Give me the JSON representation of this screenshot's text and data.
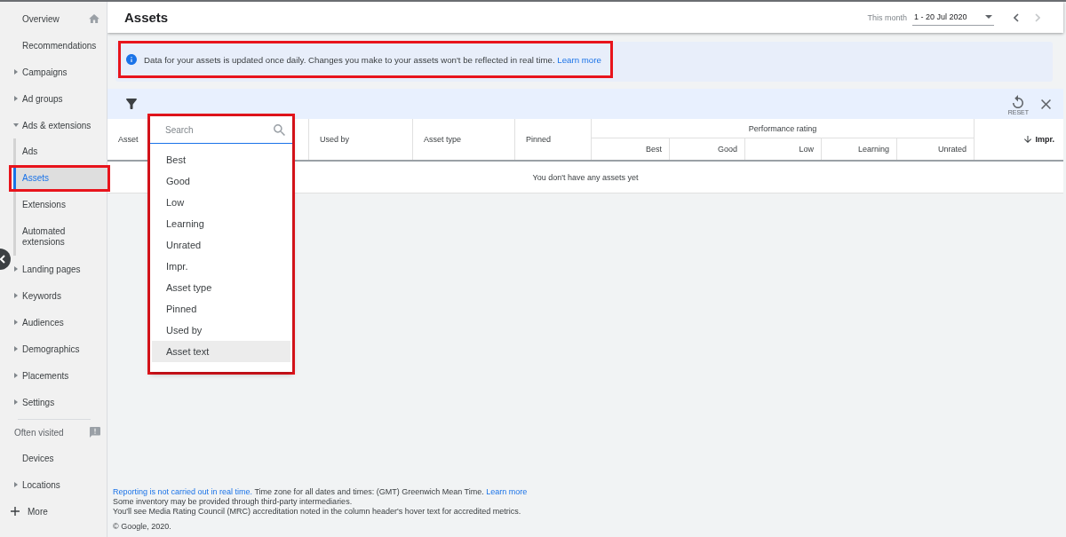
{
  "sidebar": {
    "items": [
      {
        "label": "Overview",
        "kind": "home",
        "selected": false
      },
      {
        "label": "Recommendations",
        "kind": "link",
        "selected": false
      },
      {
        "label": "Campaigns",
        "kind": "group",
        "expanded": false,
        "selected": false
      },
      {
        "label": "Ad groups",
        "kind": "group",
        "expanded": false,
        "selected": false
      },
      {
        "label": "Ads & extensions",
        "kind": "group",
        "expanded": true,
        "selected": false,
        "children": [
          {
            "label": "Ads",
            "selected": false,
            "highlighted": false
          },
          {
            "label": "Assets",
            "selected": true,
            "highlighted": true
          },
          {
            "label": "Extensions",
            "selected": false,
            "highlighted": false
          },
          {
            "label": "Automated extensions",
            "selected": false,
            "highlighted": false
          }
        ]
      },
      {
        "label": "Landing pages",
        "kind": "group",
        "expanded": false,
        "selected": false
      },
      {
        "label": "Keywords",
        "kind": "group",
        "expanded": false,
        "selected": false
      },
      {
        "label": "Audiences",
        "kind": "group",
        "expanded": false,
        "selected": false
      },
      {
        "label": "Demographics",
        "kind": "group",
        "expanded": false,
        "selected": false
      },
      {
        "label": "Placements",
        "kind": "group",
        "expanded": false,
        "selected": false
      },
      {
        "label": "Settings",
        "kind": "group",
        "expanded": false,
        "selected": false
      }
    ],
    "often_visited": {
      "title": "Often visited",
      "items": [
        {
          "label": "Devices",
          "kind": "link",
          "selected": false
        },
        {
          "label": "Locations",
          "kind": "group",
          "expanded": false,
          "selected": false
        }
      ]
    },
    "more": {
      "label": "More"
    }
  },
  "header": {
    "title": "Assets",
    "period": "This month",
    "date_range": "1 - 20 Jul 2020",
    "nav": [
      {
        "kind": "prev",
        "disabled": false
      },
      {
        "kind": "next",
        "disabled": true
      }
    ]
  },
  "notice": {
    "text": "Data for your assets is updated once daily. Changes you make to your assets won't be reflected in real time.",
    "link": "Learn more",
    "highlighted": true
  },
  "filter_bar": {
    "reset_label": "RESET"
  },
  "column_menu": {
    "placeholder": "Search",
    "highlighted": true,
    "options": [
      {
        "label": "Best",
        "hovered": false
      },
      {
        "label": "Good",
        "hovered": false
      },
      {
        "label": "Low",
        "hovered": false
      },
      {
        "label": "Learning",
        "hovered": false
      },
      {
        "label": "Unrated",
        "hovered": false
      },
      {
        "label": "Impr.",
        "hovered": false
      },
      {
        "label": "Asset type",
        "hovered": false
      },
      {
        "label": "Pinned",
        "hovered": false
      },
      {
        "label": "Used by",
        "hovered": false
      },
      {
        "label": "Asset text",
        "hovered": true
      }
    ]
  },
  "table": {
    "columns": [
      {
        "label": "Asset",
        "sorted": false
      },
      {
        "label": "Used by",
        "sorted": false
      },
      {
        "label": "Asset type",
        "sorted": false
      },
      {
        "label": "Pinned",
        "sorted": false
      },
      {
        "label": "Performance rating",
        "children": [
          {
            "label": "Best",
            "sorted": false
          },
          {
            "label": "Good",
            "sorted": false
          },
          {
            "label": "Low",
            "sorted": false
          },
          {
            "label": "Learning",
            "sorted": false
          },
          {
            "label": "Unrated",
            "sorted": false
          }
        ]
      },
      {
        "label": "Impr.",
        "sorted": true,
        "descending": true
      }
    ],
    "empty_message": "You don't have any assets yet"
  },
  "footer": {
    "lines": [
      {
        "parts": [
          {
            "kind": "link",
            "text": "Reporting is not carried out in real time."
          },
          {
            "kind": "text",
            "text": " Time zone for all dates and times: (GMT) Greenwich Mean Time. "
          },
          {
            "kind": "link",
            "text": "Learn more"
          }
        ]
      },
      {
        "parts": [
          {
            "kind": "text",
            "text": "Some inventory may be provided through third-party intermediaries."
          }
        ]
      },
      {
        "parts": [
          {
            "kind": "text",
            "text": "You'll see Media Rating Council (MRC) accreditation noted in the column header's hover text for accredited metrics."
          }
        ]
      }
    ],
    "copyright": "© Google, 2020."
  }
}
